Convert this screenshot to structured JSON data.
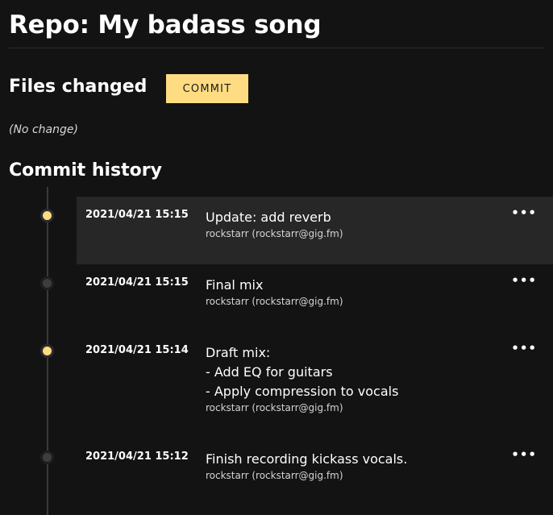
{
  "repo": {
    "title": "Repo: My badass song"
  },
  "files": {
    "heading": "Files changed",
    "commit_button": "COMMIT",
    "status": "(No change)"
  },
  "history": {
    "heading": "Commit history",
    "commits": [
      {
        "date": "2021/04/21 15:15",
        "message": "Update: add reverb",
        "author": "rockstarr (rockstarr@gig.fm)",
        "dot": "yellow",
        "selected": true,
        "more": "•••"
      },
      {
        "date": "2021/04/21 15:15",
        "message": "Final mix",
        "author": "rockstarr (rockstarr@gig.fm)",
        "dot": "gray",
        "selected": false,
        "more": "•••"
      },
      {
        "date": "2021/04/21 15:14",
        "message": "Draft mix:\n- Add EQ for guitars\n- Apply compression to vocals",
        "author": "rockstarr (rockstarr@gig.fm)",
        "dot": "yellow",
        "selected": false,
        "more": "•••"
      },
      {
        "date": "2021/04/21 15:12",
        "message": "Finish recording kickass vocals.",
        "author": "rockstarr (rockstarr@gig.fm)",
        "dot": "gray",
        "selected": false,
        "more": "•••"
      }
    ]
  },
  "colors": {
    "background": "#131313",
    "accent": "#ffdc82",
    "selected_row": "#272727",
    "dot_inactive": "#3d3d3d"
  }
}
